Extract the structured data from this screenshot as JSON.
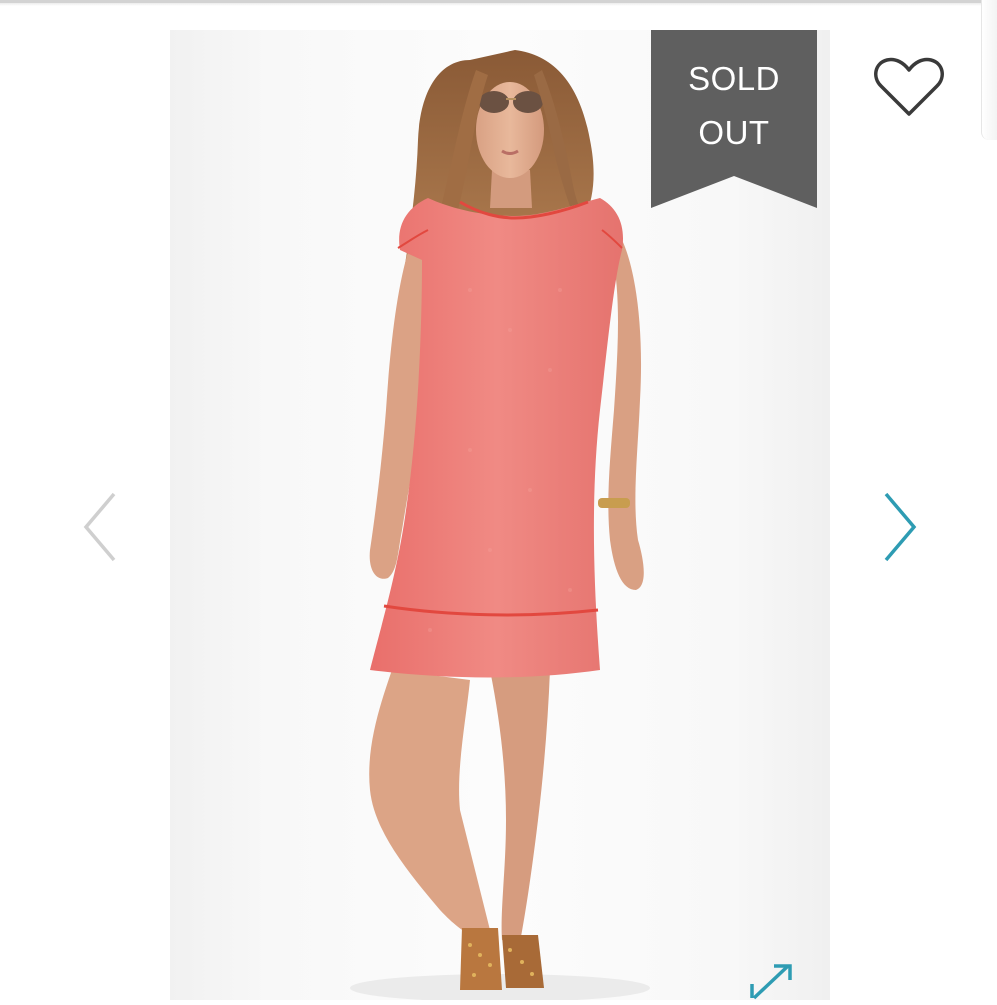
{
  "badge": {
    "line1": "SOLD",
    "line2": "OUT",
    "color": "#5f5f5f"
  },
  "icons": {
    "favorite": "heart-outline-icon",
    "previous": "chevron-left-icon",
    "next": "chevron-right-icon",
    "expand": "expand-diagonal-icon"
  },
  "colors": {
    "next_arrow": "#2e9cb3",
    "prev_arrow": "#cfcfcf",
    "dress": "#ef7c78",
    "dress_trim": "#e2483f"
  }
}
